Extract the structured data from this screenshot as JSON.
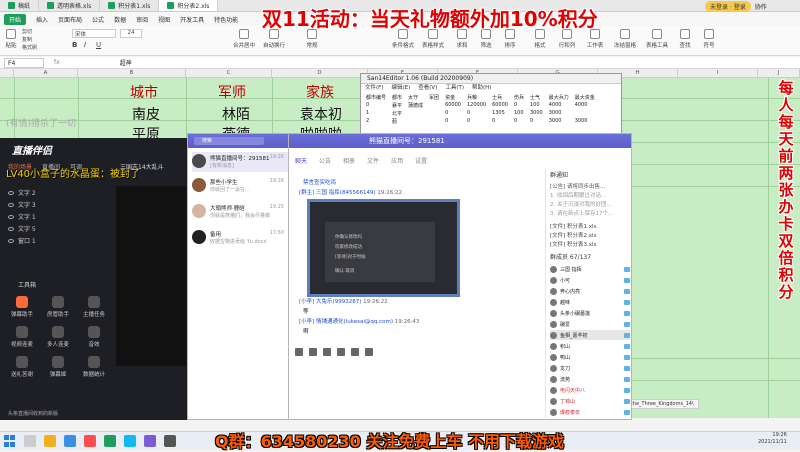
{
  "promo": {
    "top_text": "双11活动：当天礼物额外加10%积分",
    "bottom_text": "Q群：634580230 关注免费上车 不用下载游戏",
    "side_text": "每人每天前两张办卡双倍积分"
  },
  "spreadsheet": {
    "tabs": [
      "稿纸",
      "透明表格.xls",
      "积分表1.xls",
      "积分表2.xls"
    ],
    "menu": [
      "开始",
      "插入",
      "页面布局",
      "公式",
      "数据",
      "审阅",
      "视图",
      "开发工具",
      "特色功能"
    ],
    "ribbon_labels": [
      "剪切",
      "复制",
      "格式刷",
      "粘贴",
      "合并居中",
      "自动换行",
      "常规",
      "条件格式",
      "表格样式",
      "求和",
      "筛选",
      "排序",
      "格式",
      "行和列",
      "工作表",
      "冻结窗格",
      "表格工具",
      "查找",
      "符号"
    ],
    "font_name": "宋体",
    "font_size": "24",
    "name_box": "F4",
    "formula_value": "超神",
    "columns": [
      "A",
      "B",
      "C",
      "D",
      "E",
      "F",
      "G",
      "H",
      "I",
      "J"
    ],
    "cells": {
      "city": "城市",
      "commander": "军师",
      "family": "家族",
      "r1c1": "南皮",
      "r1c2": "林陌",
      "r1c3": "袁本初",
      "r2c1": "平原",
      "r2c2": "燕德",
      "r2c3": "啪啪啪"
    },
    "sheet_tab": "mon\\Romance_of_the_Three_Kingdoms_14\\"
  },
  "top_right": {
    "pill": "未登录 · 登录",
    "btn": "协作"
  },
  "data_window": {
    "title": "San14Editor 1.06 (Build 20200909)",
    "menus": [
      "文件(F)",
      "编辑(E)",
      "查看(V)",
      "工具(T)",
      "帮助(H)"
    ],
    "headers": [
      "都市编号",
      "都市",
      "太守",
      "军团",
      "资金",
      "兵粮",
      "士兵",
      "伤兵",
      "士气",
      "最大兵力",
      "最大资金"
    ],
    "rows": [
      [
        "0",
        "襄平",
        "蒲德成",
        "",
        "60000",
        "120000",
        "60000",
        "0",
        "100",
        "4000",
        "4000"
      ],
      [
        "1",
        "北平",
        "",
        "",
        "0",
        "0",
        "1305",
        "100",
        "3000",
        "3000",
        ""
      ],
      [
        "2",
        "蓟",
        "",
        "",
        "0",
        "0",
        "0",
        "0",
        "0",
        "3000",
        "3000"
      ]
    ]
  },
  "stream_app": {
    "logo": "直播伴侣",
    "tabs": [
      "我的场景",
      "直播间",
      "可调"
    ],
    "sources": [
      "文字 2",
      "文字 3",
      "文字 1",
      "文字 5",
      "窗口 1"
    ],
    "tools_title": "工具箱",
    "tools": [
      "弹幕助手",
      "房管助手",
      "主播任务",
      "视频连麦",
      "多人连麦",
      "音效",
      "送礼答谢",
      "弹幕姬",
      "数据统计"
    ],
    "footer": "头条直播间收到的新版",
    "overlay_line": "LV40小盒子的水晶蛋：被封了",
    "overlay_line2": "(有情)猎杀了一切",
    "overlay_line3": "三国志14大乱斗"
  },
  "qq_list": {
    "search_placeholder": "搜索",
    "contacts": [
      {
        "name": "熊猫直播间号：291581",
        "msg": "[有新消息]",
        "time": "19:26"
      },
      {
        "name": "那些小学生",
        "msg": "你就回了一会在…",
        "time": "19:26"
      },
      {
        "name": "大頭熊师·鹿晗",
        "msg": "你就是熊猫们，我会尽量做好…",
        "time": "19:25"
      },
      {
        "name": "备用",
        "msg": "收据宝物进贡给 'fu.docx'",
        "time": "17:50"
      }
    ]
  },
  "qq_chat": {
    "title": "熊猫直播间号：291581",
    "tabs": [
      "聊天",
      "公告",
      "相册",
      "文件",
      "应用",
      "设置"
    ],
    "msg1_prefix": "[群主] 三国 指挥",
    "msg1_link": "(845566149)",
    "msg1_time": "19:26:22",
    "msg1_text": "禁言查实吃鸡",
    "img_rows": [
      "你确认修改吗",
      "玩家修改成功",
      "[等待]对于时候",
      "确认     取消"
    ],
    "msg2_prefix": "[小李] 大兔乐",
    "msg2_link": "(9993287)",
    "msg2_time": "19:26:22",
    "msg2_text": "等",
    "msg3_prefix": "[小李] 情铺通通化",
    "msg3_link": "(lukesai@qq.com)",
    "msg3_time": "19:26:43",
    "msg3_text": "啊",
    "notice_title": "群通知",
    "notice_items": [
      "[公告] 请将同步出售…",
      "1. 收回后期跟过对话…",
      "2. 关于沉浸对我的好团…",
      "3. 请在新点上保存17个…"
    ],
    "files": [
      "[文件] 积分表1.xls",
      "[文件] 积分表2.xls",
      "[文件] 积分表3.xls"
    ],
    "members_title": "群成员 67/137",
    "members": [
      "三国 指挥",
      "小可",
      "奔心内亮",
      "越味",
      "头条小碾墓莲",
      "碾爱",
      "鱼相_嘉丰初",
      "积山",
      "鸭山",
      "龙刀",
      "流苑",
      "电闪天中八",
      "丁锦山",
      "爆痕泰泉",
      "风鉴"
    ]
  },
  "taskbar": {
    "time": "19:26",
    "date": "2021/11/11"
  },
  "colors": {
    "sheet_green": "#c8ecc4",
    "promo_red": "#e00000",
    "qq_purple": "#5b5dc9",
    "banner_orange": "#ff5a00"
  }
}
